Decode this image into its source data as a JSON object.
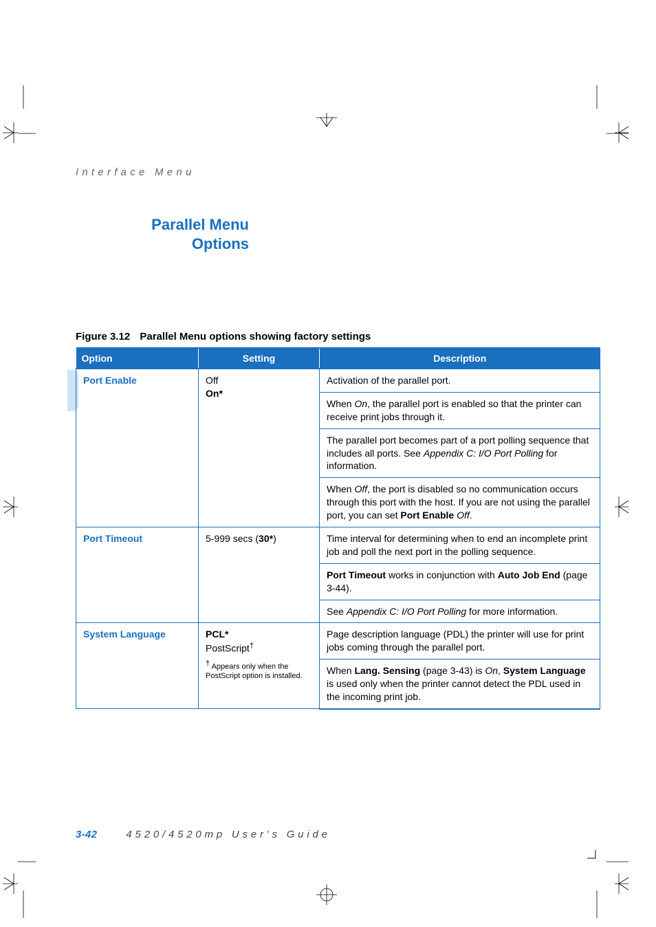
{
  "running_head": "Interface Menu",
  "heading_line1": "Parallel Menu",
  "heading_line2": "Options",
  "figure": {
    "number": "Figure 3.12",
    "title": "Parallel Menu options showing factory settings"
  },
  "table": {
    "headers": {
      "option": "Option",
      "setting": "Setting",
      "description": "Description"
    },
    "rows": [
      {
        "option": "Port Enable",
        "setting_plain": "Off",
        "setting_bold": "On*",
        "desc": [
          {
            "text": "Activation of the parallel port."
          },
          {
            "text_pre": "When ",
            "ital": "On",
            "text_post": ", the parallel port is enabled so that the printer can receive print jobs through it."
          },
          {
            "text_pre": "The parallel port becomes part of a port polling sequence that includes all ports. See ",
            "ital": "Appendix C: I/O Port Polling",
            "text_post": " for information."
          },
          {
            "text_pre": "When ",
            "ital": "Off",
            "text_mid": ", the port is disabled so no communication occurs through this port with the host. If you are not using the parallel port, you can set ",
            "bold": "Port Enable",
            "text_post2": " ",
            "ital2": "Off",
            "text_post3": "."
          }
        ]
      },
      {
        "option": "Port Timeout",
        "setting_plain_pre": "5-999 secs (",
        "setting_bold": "30*",
        "setting_plain_post": ")",
        "desc": [
          {
            "text": "Time interval for determining when to end an incomplete print job and poll the next port in the polling sequence."
          },
          {
            "bold": "Port Timeout",
            "text_mid": " works in conjunction with ",
            "bold2": "Auto Job End",
            "text_post": " (page 3-44)."
          },
          {
            "text_pre": "See ",
            "ital": "Appendix C: I/O Port Polling",
            "text_post": " for more information."
          }
        ]
      },
      {
        "option": "System Language",
        "setting_bold": "PCL*",
        "setting_plain_post_line": "PostScript",
        "dagger": "†",
        "footnote": "Appears only when the PostScript option is installed.",
        "desc": [
          {
            "text": "Page description language (PDL) the printer will use for print jobs coming through the parallel port."
          },
          {
            "text_pre": "When ",
            "bold": "Lang. Sensing",
            "text_mid": " (page 3-43) is ",
            "ital": "On",
            "text_mid2": ", ",
            "bold2": "System Language",
            "text_post": " is used only when the printer cannot detect the PDL used in the incoming print job."
          }
        ]
      }
    ]
  },
  "footer": {
    "pagenum": "3-42",
    "guide": "4520/4520mp User's Guide"
  }
}
